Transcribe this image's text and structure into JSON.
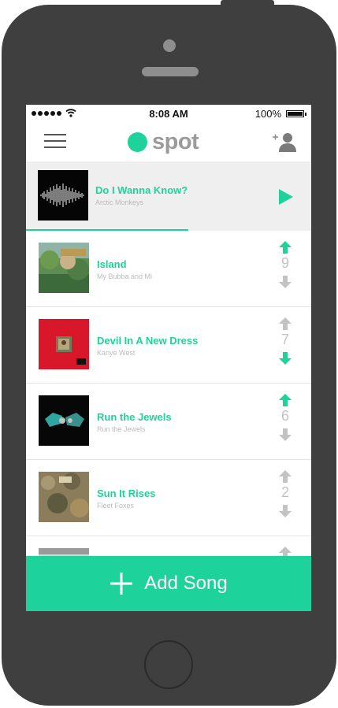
{
  "status_bar": {
    "time": "8:08 AM",
    "battery": "100%"
  },
  "header": {
    "logo_text": "spot",
    "logo_color": "#1dd39b"
  },
  "now_playing": {
    "title": "Do I Wanna Know?",
    "artist": "Arctic Monkeys",
    "progress": 0.57
  },
  "queue": [
    {
      "title": "Island",
      "artist": "My Bubba and Mi",
      "votes": "9",
      "vote_state": "up"
    },
    {
      "title": "Devil In A New Dress",
      "artist": "Kanye West",
      "votes": "7",
      "vote_state": "down"
    },
    {
      "title": "Run the Jewels",
      "artist": "Run the Jewels",
      "votes": "6",
      "vote_state": "up"
    },
    {
      "title": "Sun It Rises",
      "artist": "Fleet Foxes",
      "votes": "2",
      "vote_state": "none"
    }
  ],
  "add_song": {
    "label": "Add Song"
  },
  "icons": [
    "menu-icon",
    "add-person-icon",
    "play-icon",
    "arrow-up-icon",
    "arrow-down-icon",
    "plus-icon",
    "wifi-icon",
    "battery-icon"
  ],
  "colors": {
    "accent": "#1dd39b",
    "inactive_arrow": "#c3c3c3",
    "phone_body": "#3f3f3f"
  }
}
